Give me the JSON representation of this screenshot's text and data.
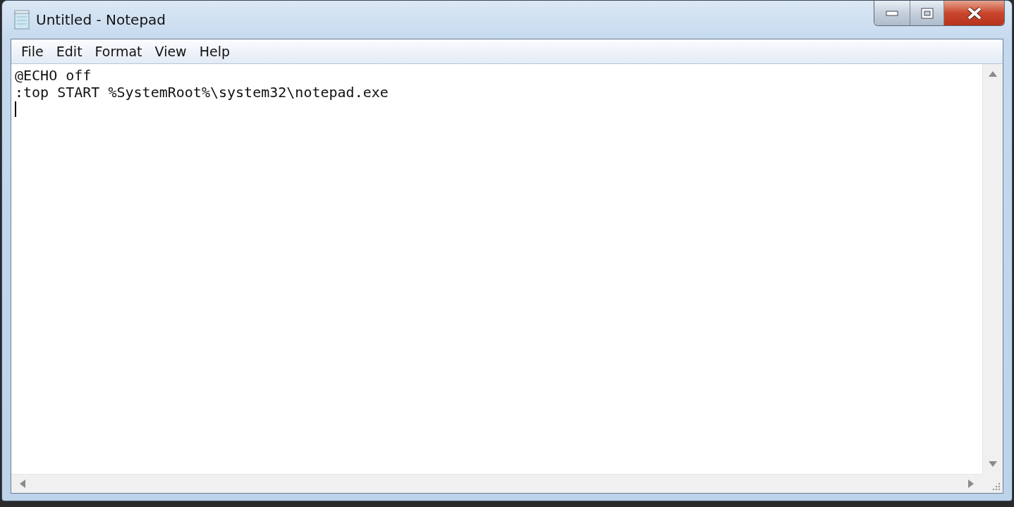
{
  "window": {
    "title": "Untitled - Notepad"
  },
  "menu": [
    {
      "label": "File"
    },
    {
      "label": "Edit"
    },
    {
      "label": "Format"
    },
    {
      "label": "View"
    },
    {
      "label": "Help"
    }
  ],
  "editor": {
    "lines": [
      "@ECHO off",
      ":top START %SystemRoot%\\system32\\notepad.exe"
    ]
  }
}
